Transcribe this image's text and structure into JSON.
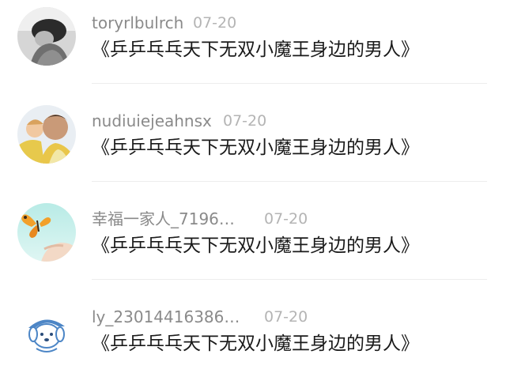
{
  "comments": [
    {
      "username": "toryrlbulrch",
      "date": "07-20",
      "content": "《乒乒乓乓天下无双小魔王身边的男人》",
      "avatar_icon": "avatar-woman-bw-icon"
    },
    {
      "username": "nudiuiejeahnsx",
      "date": "07-20",
      "content": "《乒乒乓乓天下无双小魔王身边的男人》",
      "avatar_icon": "avatar-man-child-icon"
    },
    {
      "username": "幸福一家人_7196…",
      "date": "07-20",
      "content": "《乒乒乓乓天下无双小魔王身边的男人》",
      "avatar_icon": "avatar-butterfly-hand-icon"
    },
    {
      "username": "ly_23014416386…",
      "date": "07-20",
      "content": "《乒乒乓乓天下无双小魔王身边的男人》",
      "avatar_icon": "avatar-cartoon-dog-icon"
    }
  ]
}
